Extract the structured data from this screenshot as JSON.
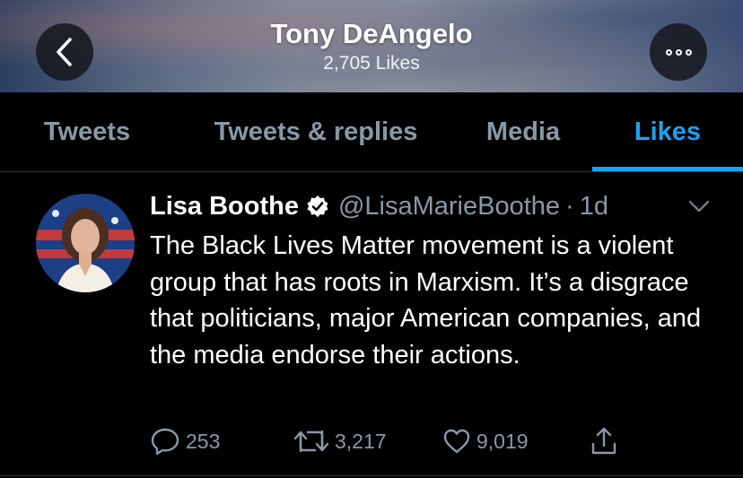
{
  "header": {
    "title": "Tony DeAngelo",
    "subtitle": "2,705 Likes"
  },
  "tabs": [
    {
      "label": "Tweets"
    },
    {
      "label": "Tweets & replies"
    },
    {
      "label": "Media"
    },
    {
      "label": "Likes"
    }
  ],
  "tweet": {
    "author_name": "Lisa Boothe",
    "handle": "@LisaMarieBoothe",
    "separator": "·",
    "time": "1d",
    "text": "The Black Lives Matter movement is a violent group that has roots in Marxism. It’s a disgrace that politicians, major American companies, and the media endorse their actions.",
    "replies": "253",
    "retweets": "3,217",
    "likes": "9,019"
  },
  "icons": {
    "back": "chevron-left-icon",
    "more": "more-dots-icon",
    "verified": "verified-badge-icon",
    "caret": "chevron-down-icon",
    "reply": "reply-icon",
    "retweet": "retweet-icon",
    "like": "heart-icon",
    "share": "share-icon"
  },
  "colors": {
    "accent": "#1da1f2",
    "muted": "#8899a6",
    "background": "#000000"
  }
}
